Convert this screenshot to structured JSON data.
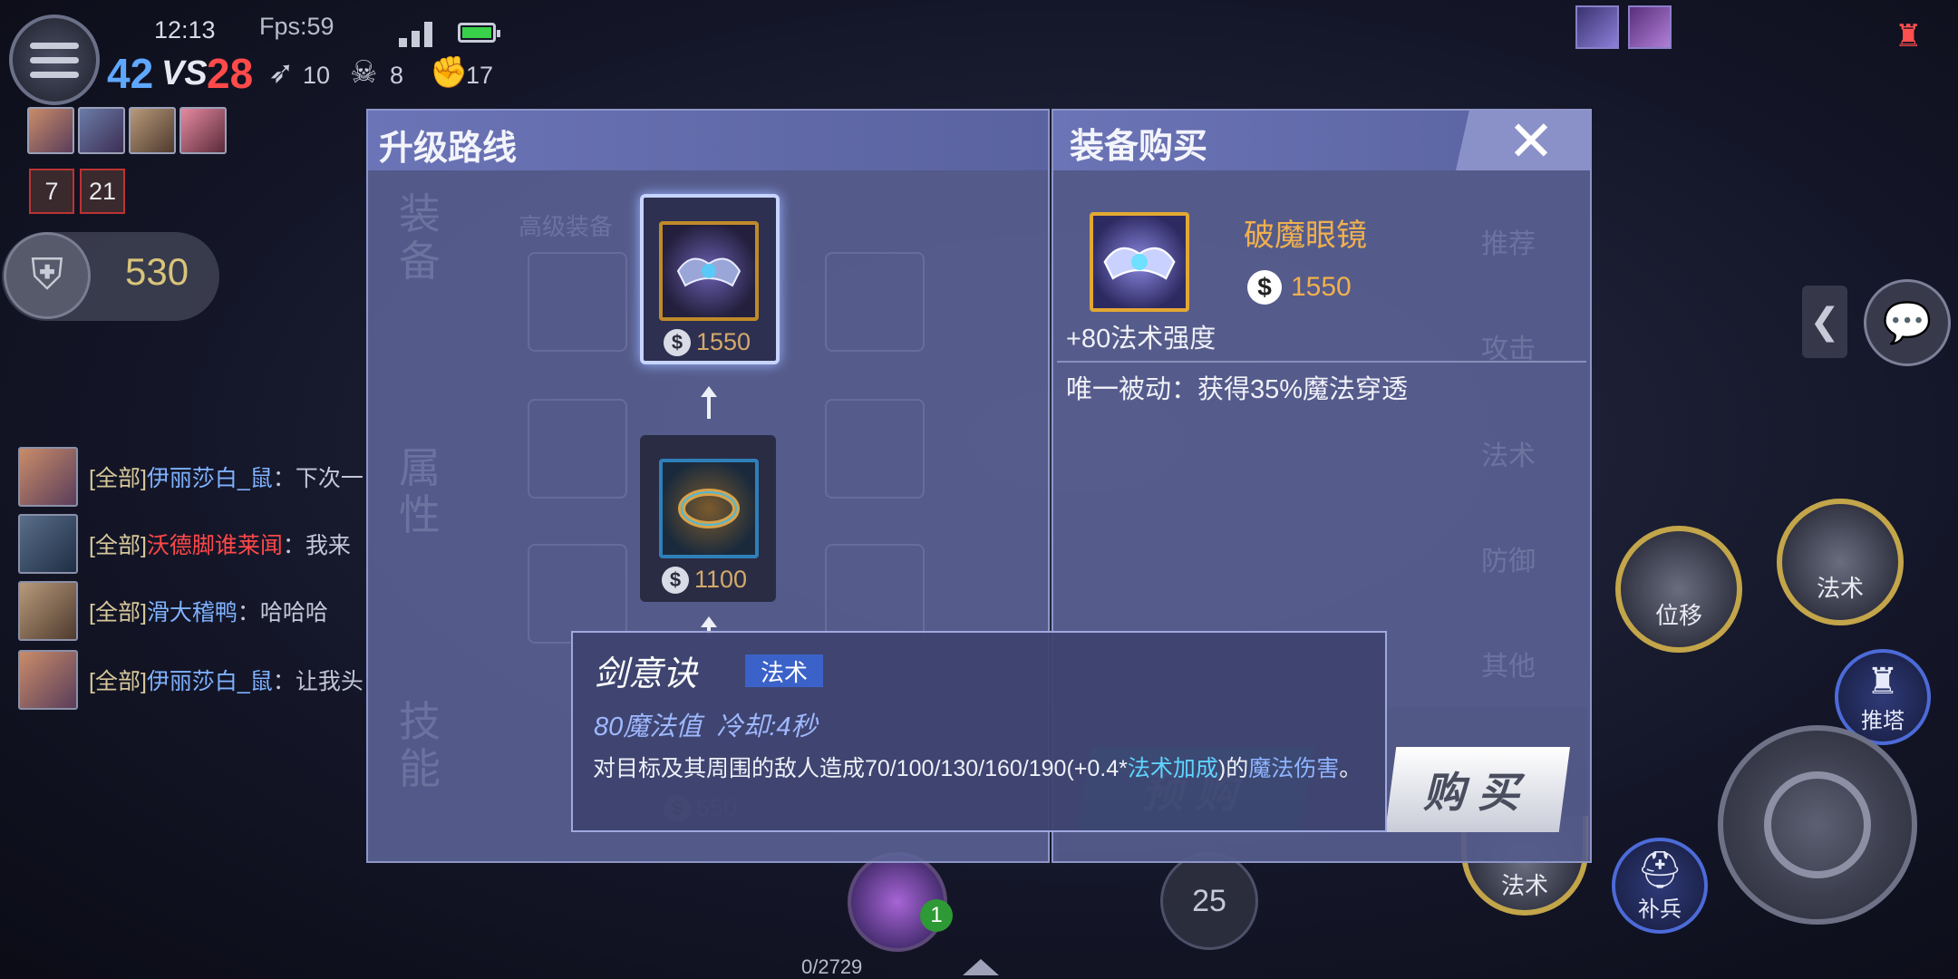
{
  "hud": {
    "time": "12:13",
    "fps": "Fps:59",
    "score_blue": "42",
    "score_vs": "VS",
    "score_red": "28",
    "kills": "10",
    "deaths": "8",
    "assists": "17",
    "tower_count_a": "7",
    "tower_count_b": "21",
    "gold": "530",
    "skill_25": "25",
    "potion_count": "1",
    "exp": "0/2729"
  },
  "chat": [
    {
      "tag": "[全部]",
      "name": "伊丽莎白_鼠",
      "msg": "：下次一",
      "name_color": "blue"
    },
    {
      "tag": "[全部]",
      "name": "沃德脚谁莱闻",
      "msg": "：我来",
      "name_color": "red"
    },
    {
      "tag": "[全部]",
      "name": "滑大稽鸭",
      "msg": "：哈哈哈",
      "name_color": "blue"
    },
    {
      "tag": "[全部]",
      "name": "伊丽莎白_鼠",
      "msg": "：让我头",
      "name_color": "blue"
    }
  ],
  "right_hud": {
    "skill_move": "位移",
    "skill_magic": "法术",
    "skill_magic_2": "法术",
    "tower_push": "推塔",
    "minion": "补兵"
  },
  "upgrade_panel": {
    "title": "升级路线",
    "bg_tabs": [
      "装备",
      "属性",
      "技能"
    ],
    "bg_label": "高级装备",
    "items": [
      {
        "price": "1550",
        "selected": true
      },
      {
        "price": "1100",
        "selected": false
      }
    ],
    "faint_price": "550"
  },
  "shop_panel": {
    "title": "装备购买",
    "bg_tabs": [
      "推荐",
      "攻击",
      "法术",
      "防御",
      "其他"
    ],
    "item_name": "破魔眼镜",
    "item_price": "1550",
    "item_stat": "+80法术强度",
    "item_passive": "唯一被动：获得35%魔法穿透",
    "prebuy_label": "预购",
    "buy_label": "购买"
  },
  "tooltip": {
    "skill_name": "剑意诀",
    "tag": "法术",
    "cost": "80魔法值  冷却:4秒",
    "desc_prefix": "对目标及其周围的敌人造成70/100/130/160/190(+0.4*",
    "desc_highlight": "法术加成",
    "desc_mid": ")的",
    "desc_link": "魔法伤害",
    "desc_suffix": "。"
  },
  "colors": {
    "accent_gold": "#f0b04e",
    "blue_team": "#5fa7ff",
    "red_team": "#ff4a4a",
    "highlight": "#5fd4ff"
  }
}
